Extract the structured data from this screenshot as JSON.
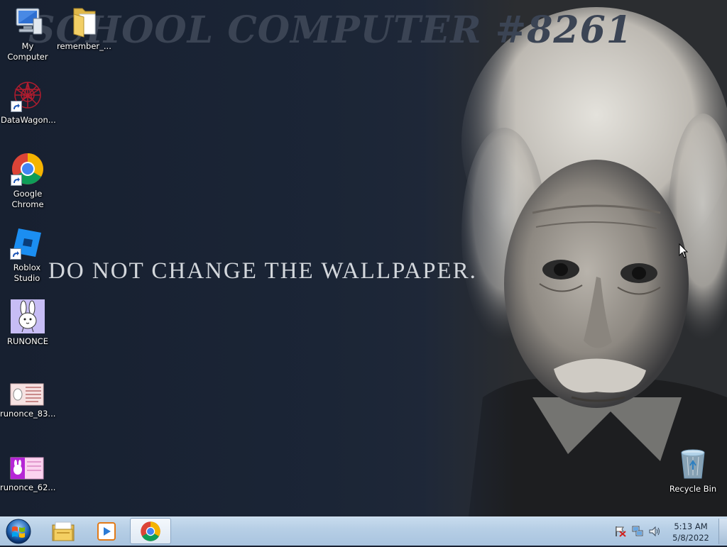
{
  "wallpaper": {
    "title": "SCHOOL COMPUTER #8261",
    "warning": "DO NOT CHANGE THE WALLPAPER."
  },
  "desktop_icons": [
    {
      "label": "My Computer",
      "icon": "computer-icon"
    },
    {
      "label": "remember_...",
      "icon": "folder-icon"
    },
    {
      "label": "DataWagon...",
      "icon": "datawagon-icon"
    },
    {
      "label": "Google Chrome",
      "icon": "chrome-icon"
    },
    {
      "label": "Roblox Studio",
      "icon": "roblox-studio-icon"
    },
    {
      "label": "RUNONCE",
      "icon": "bunny-icon"
    },
    {
      "label": "runonce_83...",
      "icon": "image-thumbnail-icon"
    },
    {
      "label": "runonce_62...",
      "icon": "image-thumbnail-icon"
    },
    {
      "label": "Recycle Bin",
      "icon": "recycle-bin-icon"
    }
  ],
  "taskbar": {
    "pinned": [
      {
        "name": "windows-explorer",
        "icon": "folder-icon"
      },
      {
        "name": "media-player",
        "icon": "media-player-icon"
      },
      {
        "name": "google-chrome",
        "icon": "chrome-icon",
        "active": true
      }
    ],
    "tray": {
      "icons": [
        "action-center-flag-icon",
        "network-icon",
        "volume-icon"
      ],
      "time": "5:13 AM",
      "date": "5/8/2022"
    }
  },
  "colors": {
    "desktop_bg": "#1b2536",
    "taskbar": "#b7cfe6",
    "warning_text": "#d3d7dc"
  }
}
